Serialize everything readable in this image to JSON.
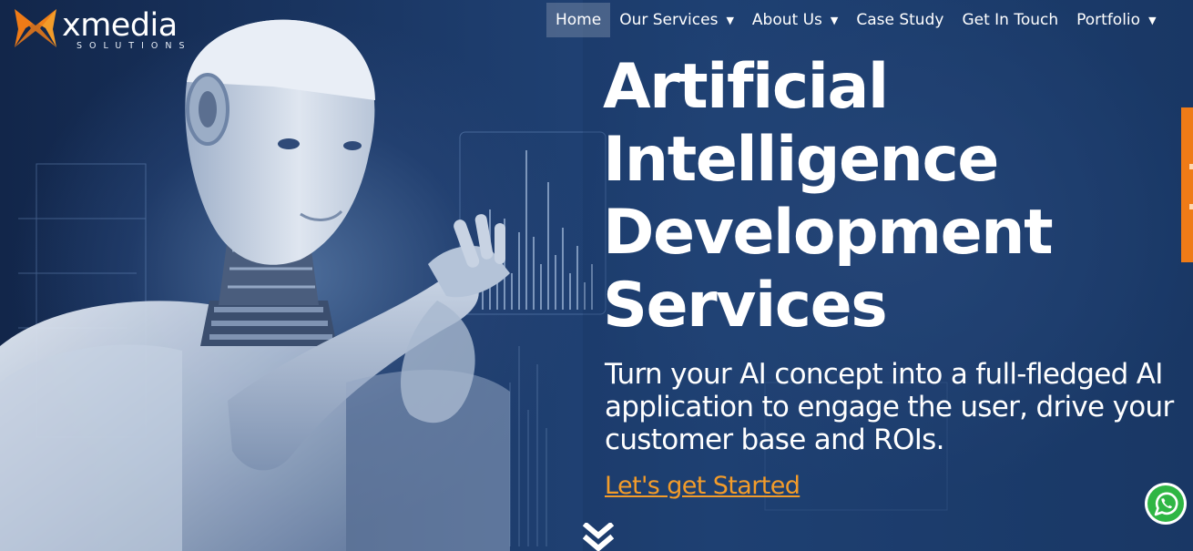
{
  "brand": {
    "name": "xmedia",
    "tagline": "SOLUTIONS",
    "accent_color": "#f39c2a",
    "logo_color": "#ef7b17"
  },
  "nav": {
    "items": [
      {
        "label": "Home",
        "active": true,
        "has_dropdown": false
      },
      {
        "label": "Our Services",
        "active": false,
        "has_dropdown": true
      },
      {
        "label": "About Us",
        "active": false,
        "has_dropdown": true
      },
      {
        "label": "Case Study",
        "active": false,
        "has_dropdown": false
      },
      {
        "label": "Get In Touch",
        "active": false,
        "has_dropdown": false
      },
      {
        "label": "Portfolio",
        "active": false,
        "has_dropdown": true
      }
    ],
    "dropdown_glyph": "▼"
  },
  "hero": {
    "title_lines": [
      "Artificial",
      "Intelligence",
      "Development",
      "Services"
    ],
    "subtitle": "Turn your AI concept into a full-fledged AI application to engage the user, drive your customer base and ROIs.",
    "cta_label": "Let's get Started"
  },
  "icons": {
    "scroll": "double-chevron-down-icon",
    "chat": "whatsapp-icon"
  }
}
